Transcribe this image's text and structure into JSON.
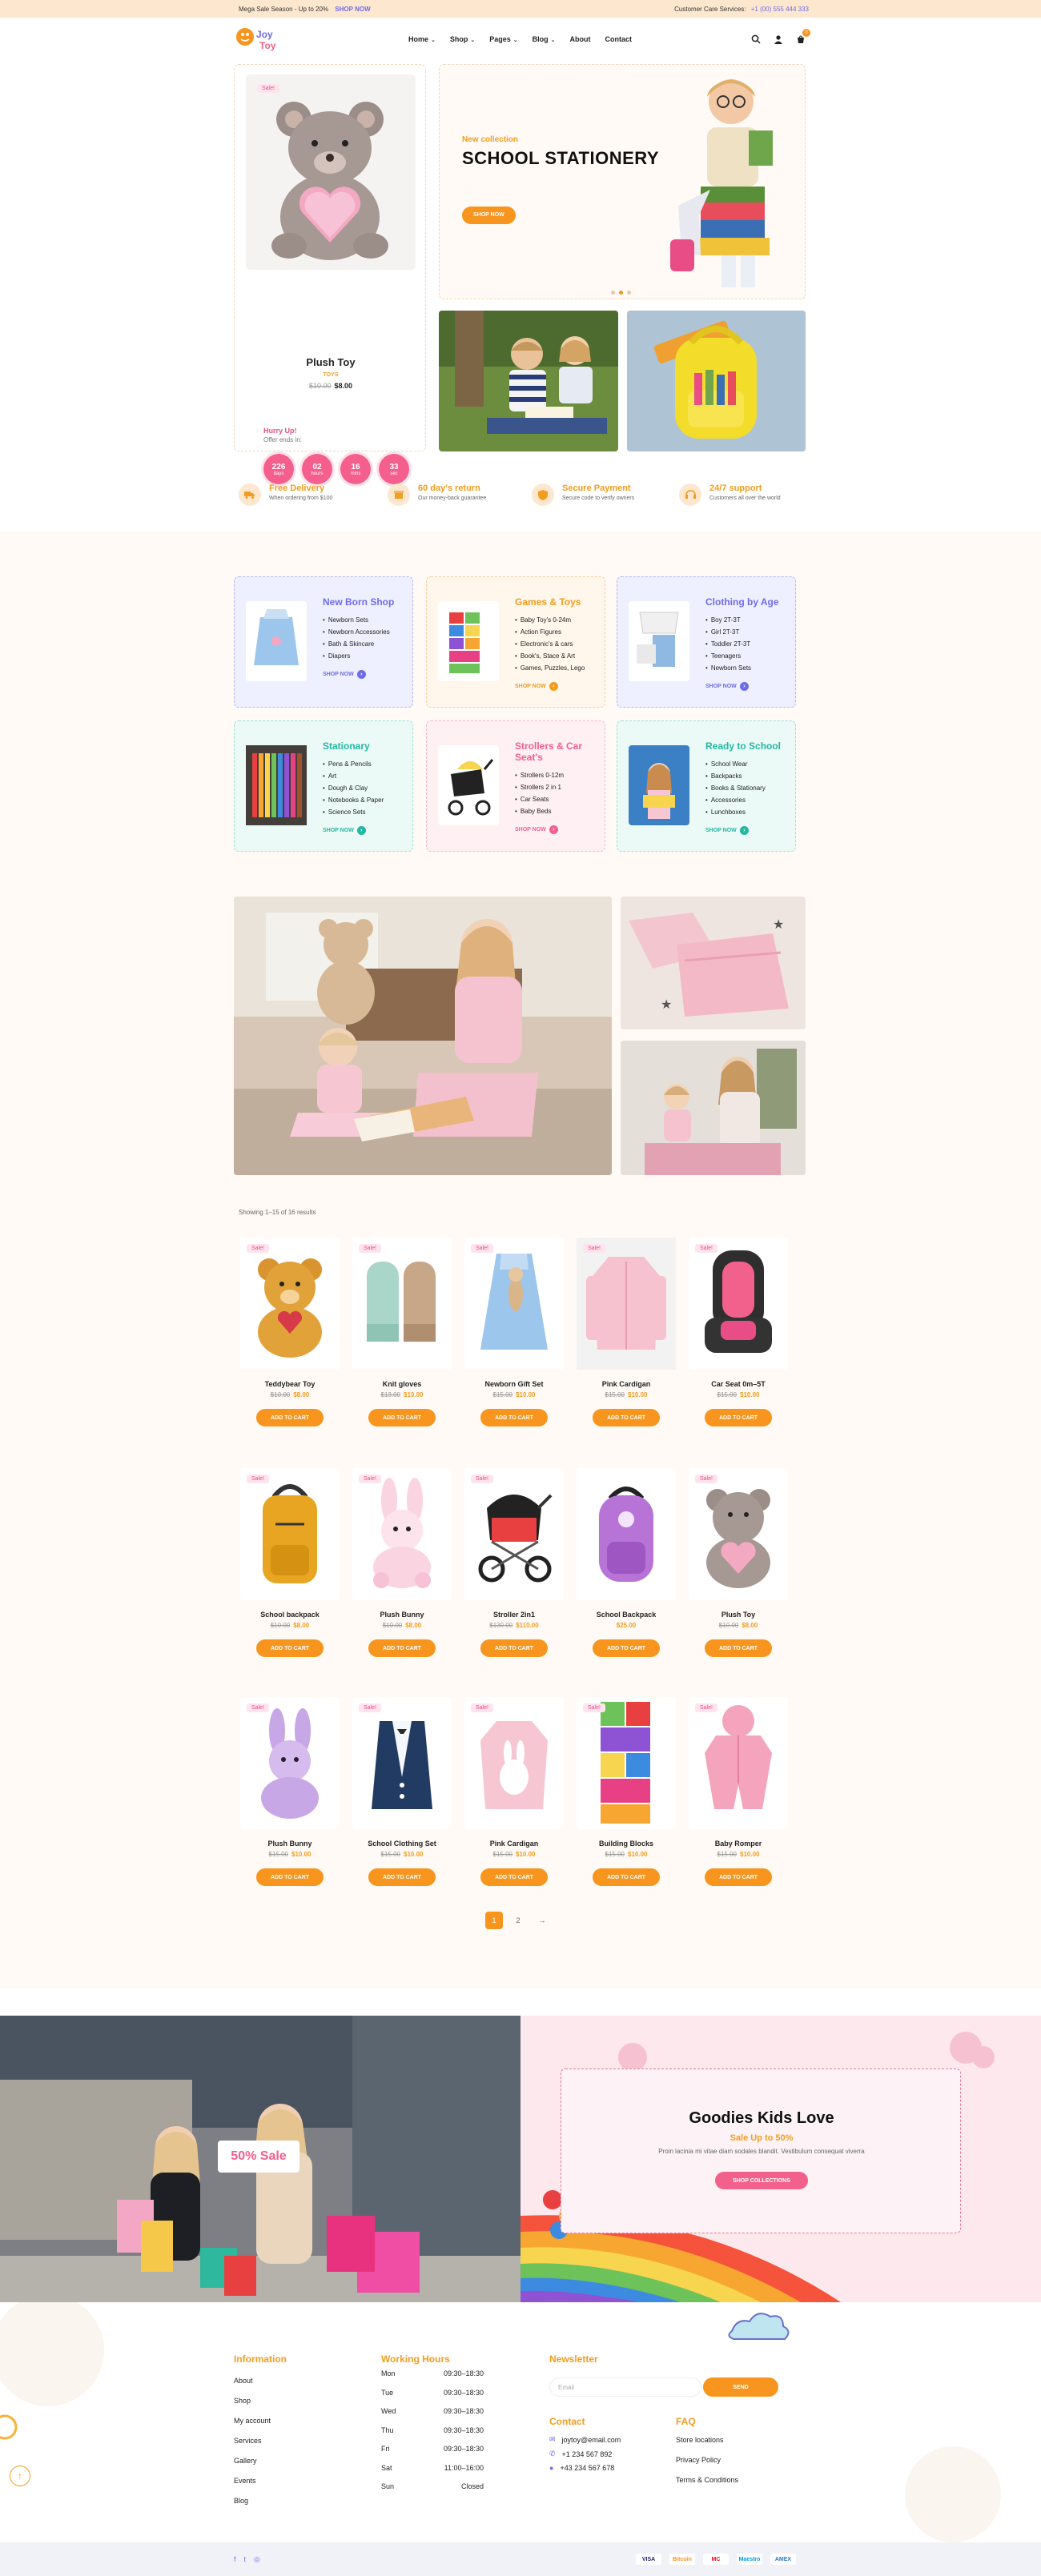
{
  "topbar": {
    "promo_text": "Mega Sale Season - Up to 20%",
    "promo_link": "SHOP NOW",
    "service_label": "Customer Care Services:",
    "service_phone": "+1 (00) 555 444 333"
  },
  "header": {
    "logo_text_1": "Joy",
    "logo_text_2": "Toy",
    "nav": [
      {
        "label": "Home",
        "chevron": true
      },
      {
        "label": "Shop",
        "chevron": true
      },
      {
        "label": "Pages",
        "chevron": true
      },
      {
        "label": "Blog",
        "chevron": true
      },
      {
        "label": "About",
        "chevron": false
      },
      {
        "label": "Contact",
        "chevron": false
      }
    ],
    "cart_count": "0"
  },
  "hero": {
    "product": {
      "badge": "Sale!",
      "name": "Plush Toy",
      "brand": "TOYS",
      "old_price": "$10.00",
      "price": "$8.00",
      "hurry": "Hurry Up!",
      "offer": "Offer ends in:",
      "countdown": [
        {
          "value": "226",
          "unit": "days"
        },
        {
          "value": "02",
          "unit": "hours"
        },
        {
          "value": "16",
          "unit": "mins"
        },
        {
          "value": "33",
          "unit": "sec"
        }
      ]
    },
    "banner": {
      "kicker": "New collection",
      "title": "SCHOOL STATIONERY",
      "button": "SHOP NOW"
    }
  },
  "features": [
    {
      "title": "Free Delivery",
      "sub": "When ordering from $100"
    },
    {
      "title": "60 day's return",
      "sub": "Our money-back guarantee"
    },
    {
      "title": "Secure Payment",
      "sub": "Secure code to verify owners"
    },
    {
      "title": "24/7 support",
      "sub": "Customers all over the world"
    }
  ],
  "categories": [
    {
      "title": "New Born Shop",
      "color": "#6f6ce8",
      "bg": "#eff0ff",
      "border": "#b8b6f2",
      "items": [
        "Newborn Sets",
        "Newborn Accessories",
        "Bath & Skincare",
        "Diapers"
      ],
      "shop": "SHOP NOW"
    },
    {
      "title": "Games & Toys",
      "color": "#f39c1f",
      "bg": "#fff6ec",
      "border": "#f5cfa3",
      "items": [
        "Baby Toy's 0-24m",
        "Action Figures",
        "Electronic's & cars",
        "Book's, Stace & Art",
        "Games, Puzzles, Lego"
      ],
      "shop": "SHOP NOW"
    },
    {
      "title": "Clothing by Age",
      "color": "#6f6ce8",
      "bg": "#eff0ff",
      "border": "#b8b6f2",
      "items": [
        "Boy 2T-3T",
        "Girl 2T-3T",
        "Toddler 2T-3T",
        "Teenagers",
        "Newborn Sets"
      ],
      "shop": "SHOP NOW"
    },
    {
      "title": "Stationary",
      "color": "#22b8a2",
      "bg": "#ebfaf6",
      "border": "#9fe1d4",
      "items": [
        "Pens & Pencils",
        "Art",
        "Dough & Clay",
        "Notebooks & Paper",
        "Science Sets"
      ],
      "shop": "SHOP NOW"
    },
    {
      "title": "Strollers & Car Seat's",
      "color": "#f2608c",
      "bg": "#fff0f4",
      "border": "#f5b9cc",
      "items": [
        "Strollers 0-12m",
        "Strollers 2 in 1",
        "Car Seats",
        "Baby Beds"
      ],
      "shop": "SHOP NOW"
    },
    {
      "title": "Ready to School",
      "color": "#22b8a2",
      "bg": "#ebfaf6",
      "border": "#9fe1d4",
      "items": [
        "School Wear",
        "Backpacks",
        "Books & Stationary",
        "Accessories",
        "Lunchboxes"
      ],
      "shop": "SHOP NOW"
    }
  ],
  "products": {
    "results": "Showing 1–15 of 16 results",
    "add_label": "ADD TO CART",
    "items": [
      {
        "name": "Teddybear Toy",
        "old": "$10.00",
        "price": "$8.00",
        "sale": "Sale!",
        "icon": "teddy-bear"
      },
      {
        "name": "Knit gloves",
        "old": "$13.00",
        "price": "$10.00",
        "sale": "Sale!",
        "icon": "gloves"
      },
      {
        "name": "Newborn Gift Set",
        "old": "$15.00",
        "price": "$10.00",
        "sale": "Sale!",
        "icon": "dress"
      },
      {
        "name": "Pink Cardigan",
        "old": "$15.00",
        "price": "$10.00",
        "sale": "Sale!",
        "icon": "cardigan"
      },
      {
        "name": "Car Seat 0m–5T",
        "old": "$15.00",
        "price": "$10.00",
        "sale": "Sale!",
        "icon": "car-seat"
      },
      {
        "name": "School backpack",
        "old": "$10.00",
        "price": "$8.00",
        "sale": "Sale!",
        "icon": "backpack"
      },
      {
        "name": "Plush Bunny",
        "old": "$10.00",
        "price": "$8.00",
        "sale": "Sale!",
        "icon": "bunny"
      },
      {
        "name": "Stroller 2in1",
        "old": "$130.00",
        "price": "$110.00",
        "sale": "Sale!",
        "icon": "stroller"
      },
      {
        "name": "School Backpack",
        "old": "",
        "price": "$25.00",
        "sale": "",
        "icon": "backpack-purple"
      },
      {
        "name": "Plush Toy",
        "old": "$10.00",
        "price": "$8.00",
        "sale": "Sale!",
        "icon": "plush"
      },
      {
        "name": "Plush Bunny",
        "old": "$15.00",
        "price": "$10.00",
        "sale": "Sale!",
        "icon": "bunny-purple"
      },
      {
        "name": "School Clothing Set",
        "old": "$15.00",
        "price": "$10.00",
        "sale": "Sale!",
        "icon": "vest"
      },
      {
        "name": "Pink Cardigan",
        "old": "$15.00",
        "price": "$10.00",
        "sale": "Sale!",
        "icon": "sweater"
      },
      {
        "name": "Building Blocks",
        "old": "$15.00",
        "price": "$10.00",
        "sale": "Sale!",
        "icon": "blocks"
      },
      {
        "name": "Baby Romper",
        "old": "$15.00",
        "price": "$10.00",
        "sale": "Sale!",
        "icon": "romper"
      }
    ],
    "pages": [
      "1",
      "2",
      "→"
    ]
  },
  "promo": {
    "sale_tag": "50% Sale",
    "title": "Goodies Kids Love",
    "subtitle": "Sale Up to 50%",
    "desc": "Proin lacinia mi vitae diam sodales blandit. Vestibulum consequat viverra",
    "button": "SHOP COLLECTIONS"
  },
  "footer": {
    "info_title": "Information",
    "info_links": [
      "About",
      "Shop",
      "My account",
      "Services",
      "Gallery",
      "Events",
      "Blog"
    ],
    "hours_title": "Working Hours",
    "hours": [
      {
        "day": "Mon",
        "time": "09:30–18:30"
      },
      {
        "day": "Tue",
        "time": "09:30–18:30"
      },
      {
        "day": "Wed",
        "time": "09:30–18:30"
      },
      {
        "day": "Thu",
        "time": "09:30–18:30"
      },
      {
        "day": "Fri",
        "time": "09:30–18:30"
      },
      {
        "day": "Sat",
        "time": "11:00–16:00"
      },
      {
        "day": "Sun",
        "time": "Closed"
      }
    ],
    "newsletter_title": "Newsletter",
    "email_placeholder": "Email",
    "send": "SEND",
    "contact_title": "Contact",
    "contacts": [
      "joytoy@email.com",
      "+1 234 567 892",
      "+43 234 567 678"
    ],
    "faq_title": "FAQ",
    "faq_links": [
      "Store locations",
      "Privacy Policy",
      "Terms & Conditions"
    ],
    "payments": [
      "VISA",
      "Bitcoin",
      "MC",
      "Maestro",
      "AMEX"
    ]
  }
}
